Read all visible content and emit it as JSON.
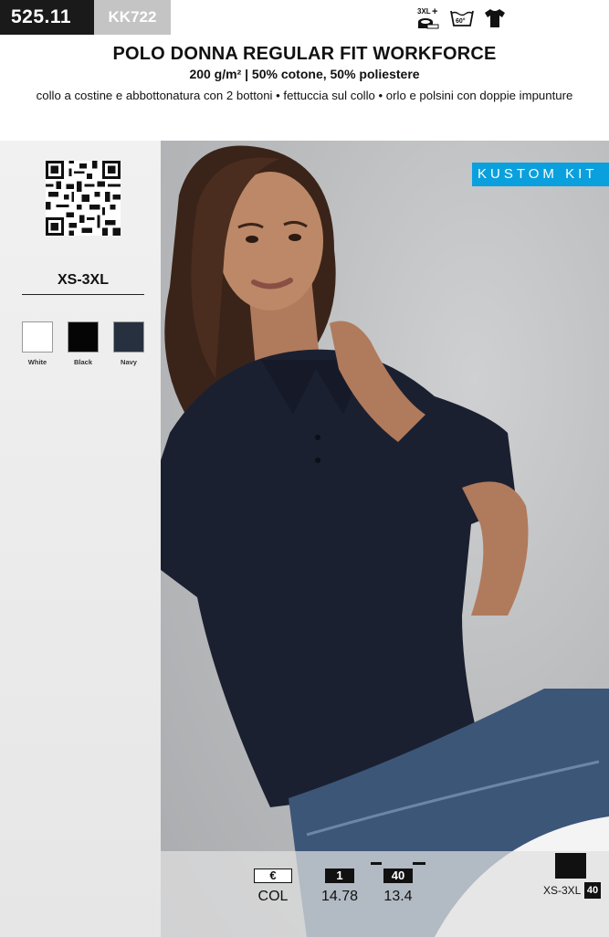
{
  "header": {
    "code": "525.11",
    "ref": "KK722",
    "care_icons": [
      "size-3xl-plus-icon",
      "wash-60-icon",
      "tshirt-icon"
    ],
    "care_size_label": "3XL",
    "care_wash_label": "60°"
  },
  "product": {
    "title": "POLO DONNA REGULAR FIT WORKFORCE",
    "subtitle": "200 g/m² | 50% cotone, 50% poliestere",
    "features": "collo a costine e abbottonatura con 2 bottoni • fettuccia sul collo • orlo e polsini con doppie impunture"
  },
  "sizes": {
    "range": "XS-3XL"
  },
  "colors": [
    {
      "name": "White",
      "hex": "#ffffff"
    },
    {
      "name": "Black",
      "hex": "#050505"
    },
    {
      "name": "Navy",
      "hex": "#26303f"
    }
  ],
  "brand": {
    "name": "KUSTOM KIT",
    "color": "#0aa0de"
  },
  "pricing": {
    "currency": "€",
    "column_label": "COL",
    "qty_1": "1",
    "price_1": "14.78",
    "qty_40": "40",
    "price_40": "13.4"
  },
  "packaging": {
    "size_range": "XS-3XL",
    "qty": "40"
  }
}
